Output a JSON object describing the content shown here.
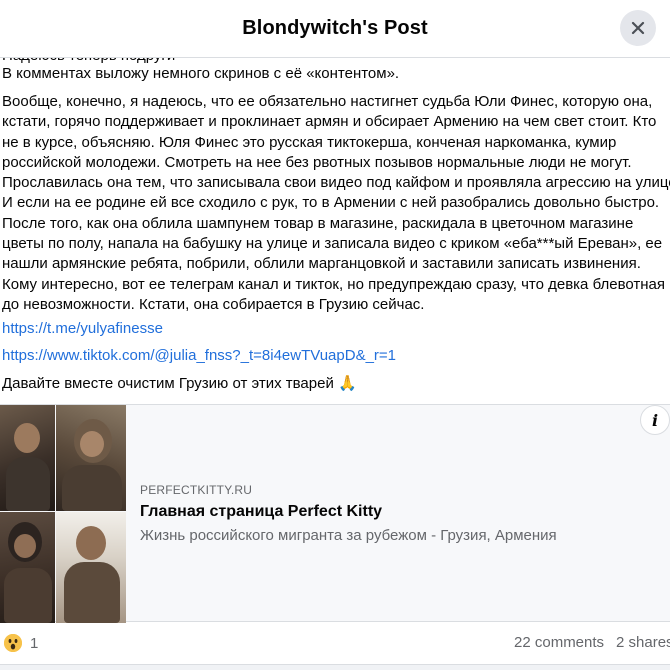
{
  "header": {
    "title": "Blondywitch's Post"
  },
  "post": {
    "cut_line": "Надеюсь теперь подруги",
    "line1": "В комментах выложу немного скринов с её «контентом».",
    "paragraph_lines": [
      "Вообще, конечно, я надеюсь, что ее обязательно настигнет судьба Юли Финес, которую она,",
      "кстати, горячо поддерживает и проклинает армян и обсирает Армению на чем свет стоит. Кто",
      "не в курсе, объясняю. Юля Финес это русская тиктокерша, конченая наркоманка, кумир",
      "российской молодежи. Смотреть на нее без рвотных позывов нормальные люди не могут.",
      "Прославилась она тем, что записывала свои видео под кайфом и проявляла агрессию на улице.",
      "И если на ее родине ей все сходило с рук, то в Армении с ней разобрались довольно быстро.",
      "После того, как она облила шампунем товар в магазине, раскидала в цветочном магазине",
      "цветы по полу, напала на бабушку на улице и записала видео с криком «еба***ый Ереван», ее",
      "нашли армянские ребята, побрили, облили марганцовкой и заставили записать извинения.",
      "Кому интересно, вот ее телеграм канал и тикток, но предупреждаю сразу, что девка блевотная",
      "до невозможности. Кстати, она собирается в Грузию сейчас."
    ],
    "link_telegram": "https://t.me/yulyafinesse",
    "link_tiktok": "https://www.tiktok.com/@julia_fnss?_t=8i4ewTVuapD&_r=1",
    "closing": "Давайте вместе очистим Грузию от этих тварей 🙏"
  },
  "card": {
    "domain": "PERFECTKITTY.RU",
    "title": "Главная страница Perfect Kitty",
    "description": "Жизнь российского мигранта за рубежом - Грузия, Армения",
    "info_label": "i"
  },
  "footer": {
    "reaction_count": "1",
    "comments": "22 comments",
    "shares": "2 shares"
  },
  "colors": {
    "link": "#216fdb",
    "muted": "#65676b",
    "divider": "#dadde1",
    "wow_yellow": "#f7c24a"
  }
}
